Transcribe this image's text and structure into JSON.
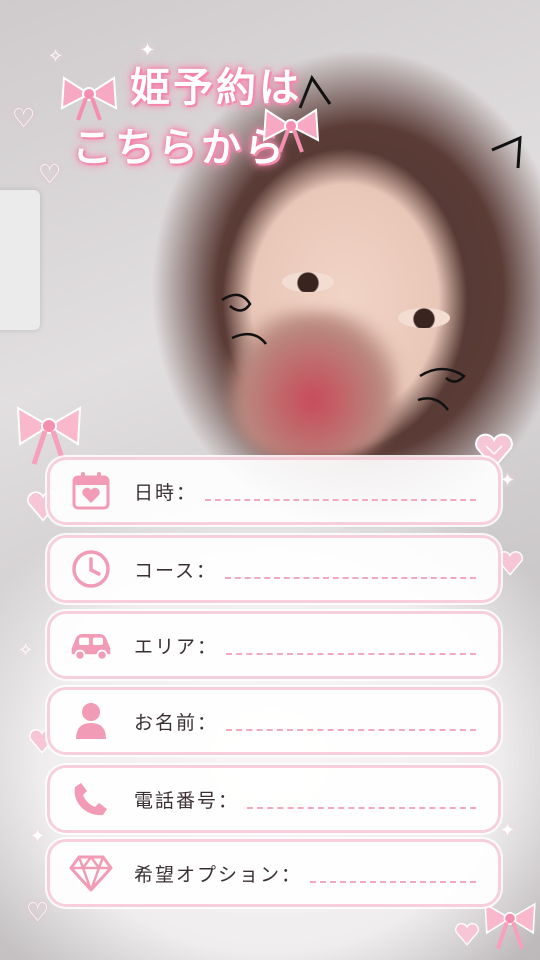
{
  "title": {
    "line1": "姫予約は",
    "line2": "こちらから"
  },
  "form": {
    "rows": [
      {
        "label": "日時：",
        "icon": "calendar-heart-icon"
      },
      {
        "label": "コース：",
        "icon": "clock-icon"
      },
      {
        "label": "エリア：",
        "icon": "car-icon"
      },
      {
        "label": "お名前：",
        "icon": "person-icon"
      },
      {
        "label": "電話番号：",
        "icon": "phone-icon"
      },
      {
        "label": "希望オプション：",
        "icon": "diamond-icon"
      }
    ]
  },
  "colors": {
    "accent_pink": "#f48fb1",
    "icon_pink": "#f29bb6",
    "dash_pink": "#f2a9c0",
    "label_text": "#3a3033"
  }
}
